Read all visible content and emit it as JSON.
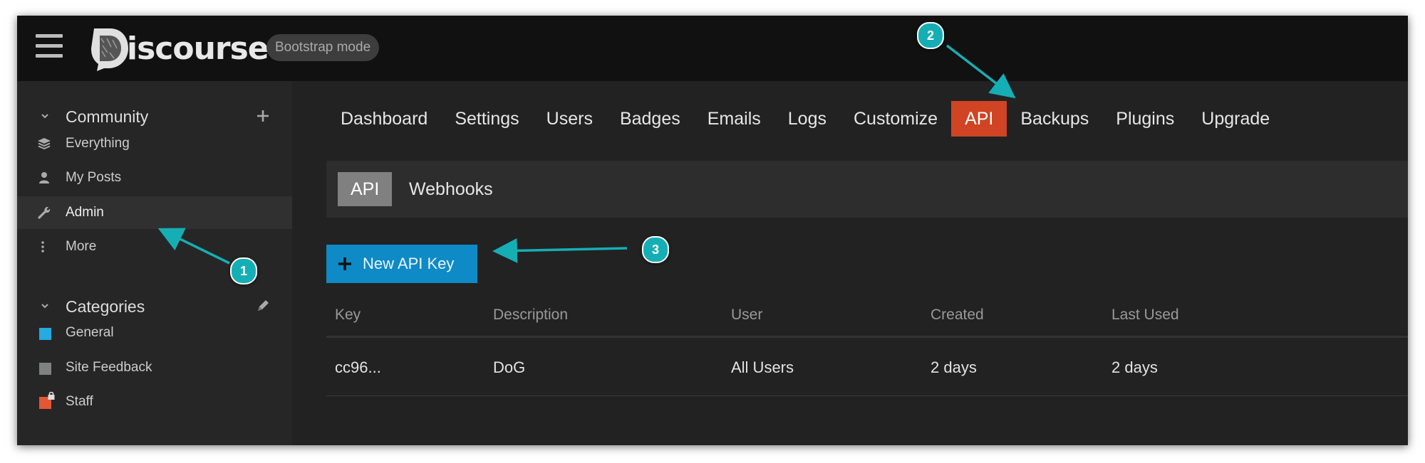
{
  "header": {
    "logo_text": "iscourse",
    "badge": "Bootstrap mode"
  },
  "sidebar": {
    "community": {
      "title": "Community",
      "items": [
        {
          "label": "Everything",
          "icon": "layers-icon"
        },
        {
          "label": "My Posts",
          "icon": "user-icon"
        },
        {
          "label": "Admin",
          "icon": "wrench-icon",
          "active": true
        },
        {
          "label": "More",
          "icon": "vertical-ellipsis-icon"
        }
      ]
    },
    "categories": {
      "title": "Categories",
      "items": [
        {
          "label": "General",
          "color": "#25aae2"
        },
        {
          "label": "Site Feedback",
          "color": "#808281"
        },
        {
          "label": "Staff",
          "color": "#e45735",
          "locked": true
        }
      ]
    }
  },
  "admin_nav": {
    "items": [
      "Dashboard",
      "Settings",
      "Users",
      "Badges",
      "Emails",
      "Logs",
      "Customize",
      "API",
      "Backups",
      "Plugins",
      "Upgrade"
    ],
    "active": "API"
  },
  "sub_nav": {
    "tabs": [
      "API",
      "Webhooks"
    ],
    "active": "API"
  },
  "new_api_key_button": "New API Key",
  "table": {
    "columns": [
      "Key",
      "Description",
      "User",
      "Created",
      "Last Used"
    ],
    "rows": [
      [
        "cc96...",
        "DoG",
        "All Users",
        "2 days",
        "2 days"
      ]
    ]
  },
  "callouts": [
    "1",
    "2",
    "3"
  ],
  "colors": {
    "accent_active": "#d04423",
    "button_primary": "#0e8ac6",
    "callout": "#16aeb5",
    "header_bg": "#111111",
    "body_bg": "#222222"
  }
}
